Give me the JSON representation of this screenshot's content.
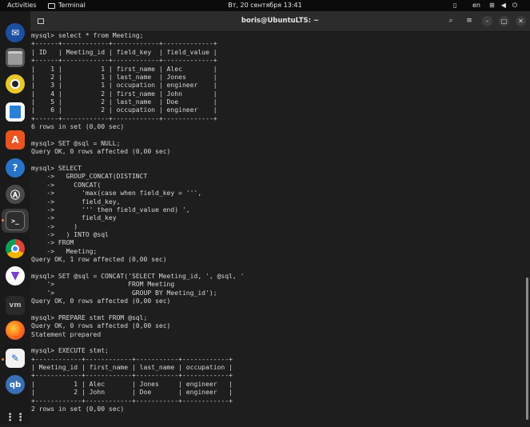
{
  "topbar": {
    "activities": "Activities",
    "app_name": "Terminal",
    "clock": "Вт, 20 сентября  13:41",
    "language": "en"
  },
  "dock": {
    "icons": [
      "thunderbird-icon",
      "files-icon",
      "rhythmbox-icon",
      "libreoffice-writer-icon",
      "app-center-icon",
      "help-icon",
      "settings-icon",
      "terminal-icon",
      "chrome-icon",
      "vpn-icon",
      "vmware-icon",
      "firefox-icon",
      "text-editor-icon",
      "qbittorrent-icon",
      "show-apps-icon"
    ]
  },
  "terminal": {
    "title": "boris@UbuntuLTS: ~",
    "lines": [
      "mysql> select * from Meeting;",
      "+------+------------+------------+-------------+",
      "| ID   | Meeting_id | field_key  | field_value |",
      "+------+------------+------------+-------------+",
      "|    1 |          1 | first_name | Alec        |",
      "|    2 |          1 | last_name  | Jones       |",
      "|    3 |          1 | occupation | engineer    |",
      "|    4 |          2 | first_name | John        |",
      "|    5 |          2 | last_name  | Doe         |",
      "|    6 |          2 | occupation | engineer    |",
      "+------+------------+------------+-------------+",
      "6 rows in set (0,00 sec)",
      "",
      "mysql> SET @sql = NULL;",
      "Query OK, 0 rows affected (0,00 sec)",
      "",
      "mysql> SELECT",
      "    ->   GROUP_CONCAT(DISTINCT",
      "    ->     CONCAT(",
      "    ->       'max(case when field_key = ''',",
      "    ->       field_key,",
      "    ->       ''' then field_value end) ',",
      "    ->       field_key",
      "    ->     )",
      "    ->   ) INTO @sql",
      "    -> FROM",
      "    ->   Meeting;",
      "Query OK, 1 row affected (0,00 sec)",
      "",
      "mysql> SET @sql = CONCAT('SELECT Meeting_id, ', @sql, '",
      "    '>                   FROM Meeting",
      "    '>                    GROUP BY Meeting_id');",
      "Query OK, 0 rows affected (0,00 sec)",
      "",
      "mysql> PREPARE stmt FROM @sql;",
      "Query OK, 0 rows affected (0,00 sec)",
      "Statement prepared",
      "",
      "mysql> EXECUTE stmt;",
      "+------------+------------+-----------+------------+",
      "| Meeting_id | first_name | last_name | occupation |",
      "+------------+------------+-----------+------------+",
      "|          1 | Alec       | Jones     | engineer   |",
      "|          2 | John       | Doe       | engineer   |",
      "+------------+------------+-----------+------------+",
      "2 rows in set (0,00 sec)"
    ]
  }
}
